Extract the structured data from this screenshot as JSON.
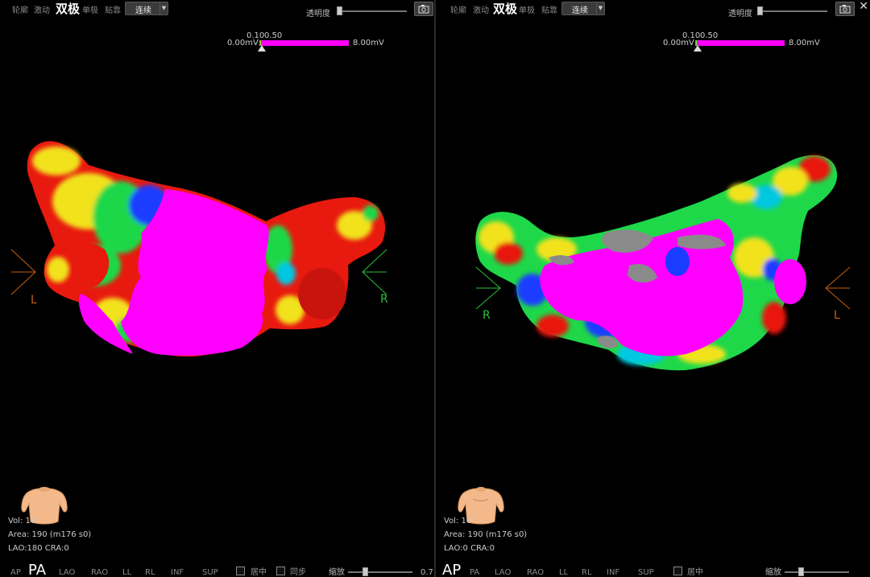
{
  "left": {
    "toolbar": {
      "modes": [
        "轮廓",
        "激动",
        "双极",
        "单极",
        "贴靠"
      ],
      "active_mode": "双极",
      "dropdown_value": "连续",
      "transparency_label": "透明度",
      "transparency_level": 0.0
    },
    "colorbar": {
      "min": "0.00mV",
      "low": "0.10",
      "high": "0.50",
      "max": "8.00mV"
    },
    "orientation": {
      "left_marker": "L",
      "right_marker": "R"
    },
    "info": {
      "vol": "Vol: 10",
      "area": "Area: 190 (m176 s0)",
      "angles": "LAO:180 CRA:0"
    },
    "views": {
      "buttons": [
        "AP",
        "PA",
        "LAO",
        "RAO",
        "LL",
        "RL",
        "INF",
        "SUP"
      ],
      "active": "PA",
      "checkbox_center": "居中",
      "checkbox_sync": "同步",
      "zoom_label": "缩放",
      "zoom_value": "0.7"
    }
  },
  "right": {
    "toolbar": {
      "modes": [
        "轮廓",
        "激动",
        "双极",
        "单极",
        "贴靠"
      ],
      "active_mode": "双极",
      "dropdown_value": "连续",
      "transparency_label": "透明度",
      "transparency_level": 0.0
    },
    "colorbar": {
      "min": "0.00mV",
      "low": "0.10",
      "high": "0.50",
      "max": "8.00mV"
    },
    "orientation": {
      "left_marker": "R",
      "right_marker": "L"
    },
    "info": {
      "vol": "Vol: 10",
      "area": "Area: 190 (m176 s0)",
      "angles": "LAO:0 CRA:0"
    },
    "views": {
      "buttons": [
        "AP",
        "PA",
        "LAO",
        "RAO",
        "LL",
        "RL",
        "INF",
        "SUP"
      ],
      "active": "AP",
      "checkbox_center": "居中",
      "zoom_label": "缩放"
    },
    "close_symbol": "✕"
  },
  "colors": {
    "magenta": "#ff00ff",
    "red": "#e8190f",
    "yellow": "#f2e21a",
    "green": "#1ed84a",
    "blue": "#1a3cff",
    "cyan": "#00c8e0",
    "grey": "#8a8a8a",
    "orange_marker": "#c8600f",
    "green_marker": "#2bbf3a"
  }
}
